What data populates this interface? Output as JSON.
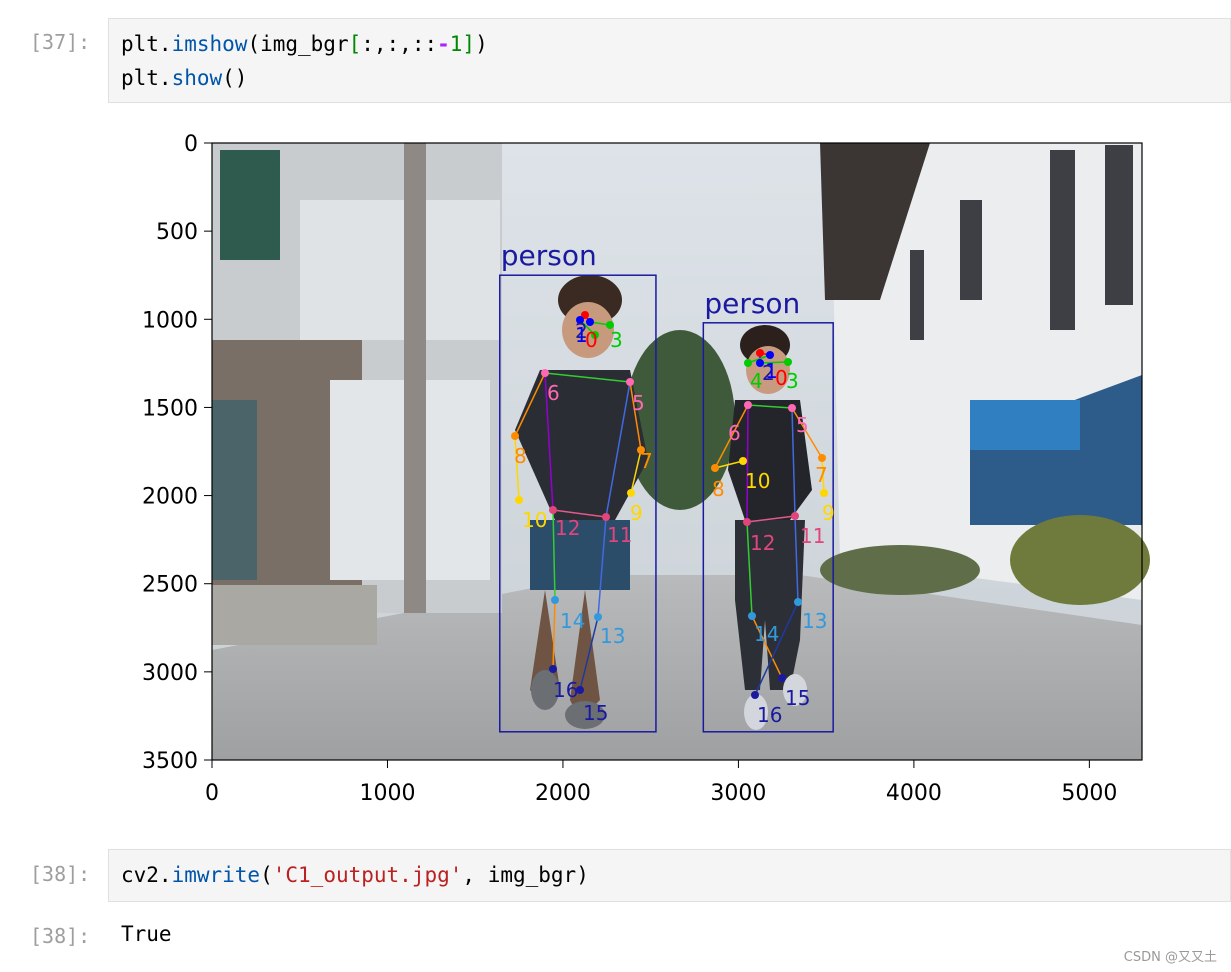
{
  "cells": [
    {
      "prompt": "[37]:",
      "code_lines": [
        {
          "plain1": "plt.",
          "fn": "imshow",
          "plain2": "(img_bgr",
          "bracket_open": "[",
          "slice": ":,:,::",
          "minus": "-",
          "num": "1",
          "bracket_close": "]",
          "plain3": ")"
        },
        {
          "plain1": "plt.",
          "fn": "show",
          "plain2": "()"
        }
      ]
    },
    {
      "prompt": "[38]:",
      "code": {
        "plain1": "cv2.",
        "fn": "imwrite",
        "plain2": "(",
        "str": "'C1_output.jpg'",
        "plain3": ", img_bgr)"
      }
    },
    {
      "prompt": "[38]:",
      "output": "True"
    }
  ],
  "figure": {
    "x_ticks": [
      "0",
      "1000",
      "2000",
      "3000",
      "4000",
      "5000"
    ],
    "y_ticks": [
      "0",
      "500",
      "1000",
      "1500",
      "2000",
      "2500",
      "3000",
      "3500"
    ],
    "detections": [
      {
        "label": "person",
        "color": "#1a1aa0"
      },
      {
        "label": "person",
        "color": "#1a1aa0"
      }
    ],
    "keypoint_labels_person1": [
      "2",
      "0",
      "1",
      "3",
      "6",
      "5",
      "8",
      "7",
      "10",
      "9",
      "12",
      "11",
      "14",
      "13",
      "16",
      "15"
    ],
    "keypoint_labels_person2": [
      "2",
      "0",
      "1",
      "4",
      "3",
      "6",
      "5",
      "8",
      "10",
      "7",
      "9",
      "12",
      "11",
      "14",
      "13",
      "15",
      "16"
    ]
  },
  "chart_data": {
    "type": "image",
    "xlim": [
      0,
      5300
    ],
    "ylim": [
      3500,
      0
    ],
    "x_ticks": [
      0,
      1000,
      2000,
      3000,
      4000,
      5000
    ],
    "y_ticks": [
      0,
      500,
      1000,
      1500,
      2000,
      2500,
      3000,
      3500
    ],
    "boxes": [
      {
        "label": "person",
        "x0": 1640,
        "y0": 750,
        "x1": 2530,
        "y1": 3340
      },
      {
        "label": "person",
        "x0": 2800,
        "y0": 1020,
        "x1": 3540,
        "y1": 3340
      }
    ]
  },
  "watermark": "CSDN @又又土"
}
